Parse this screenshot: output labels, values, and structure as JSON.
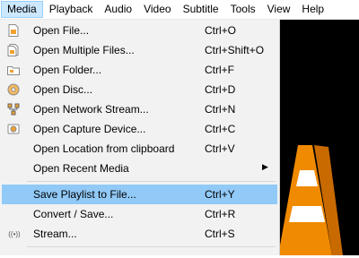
{
  "menubar": {
    "items": [
      "Media",
      "Playback",
      "Audio",
      "Video",
      "Subtitle",
      "Tools",
      "View",
      "Help"
    ]
  },
  "media_menu": {
    "items": [
      {
        "label": "Open File...",
        "shortcut": "Ctrl+O",
        "icon": "file-icon"
      },
      {
        "label": "Open Multiple Files...",
        "shortcut": "Ctrl+Shift+O",
        "icon": "files-icon"
      },
      {
        "label": "Open Folder...",
        "shortcut": "Ctrl+F",
        "icon": "folder-icon"
      },
      {
        "label": "Open Disc...",
        "shortcut": "Ctrl+D",
        "icon": "disc-icon"
      },
      {
        "label": "Open Network Stream...",
        "shortcut": "Ctrl+N",
        "icon": "network-icon"
      },
      {
        "label": "Open Capture Device...",
        "shortcut": "Ctrl+C",
        "icon": "capture-device-icon"
      },
      {
        "label": "Open Location from clipboard",
        "shortcut": "Ctrl+V",
        "icon": ""
      },
      {
        "label": "Open Recent Media",
        "shortcut": "",
        "icon": "",
        "submenu_indicator": "▶"
      },
      {
        "label": "Save Playlist to File...",
        "shortcut": "Ctrl+Y",
        "icon": ""
      },
      {
        "label": "Convert / Save...",
        "shortcut": "Ctrl+R",
        "icon": ""
      },
      {
        "label": "Stream...",
        "shortcut": "Ctrl+S",
        "icon": "stream-icon",
        "icon_glyph": "((•))"
      }
    ]
  },
  "colors": {
    "menu_bg": "#f2f2f2",
    "highlight": "#91c9f7",
    "active_title": "#cce8ff",
    "cone_orange": "#f08a00"
  }
}
